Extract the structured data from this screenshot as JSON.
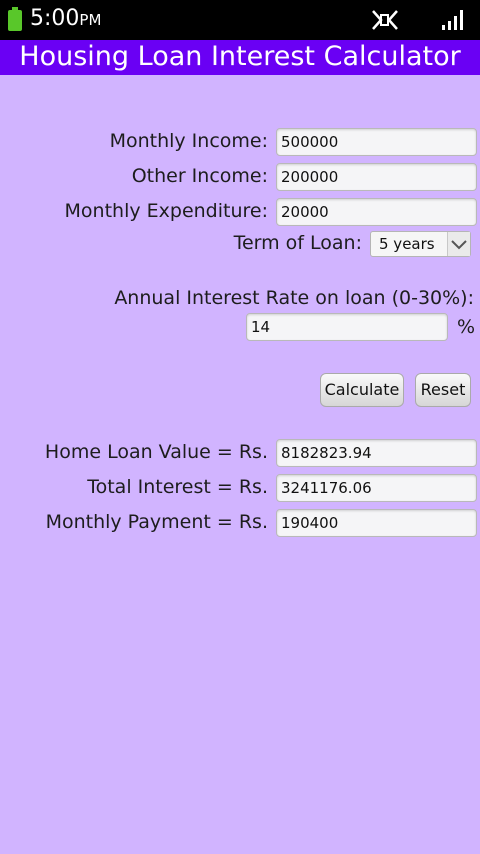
{
  "statusbar": {
    "time": "5:00",
    "ampm": "PM",
    "icons": [
      "battery-icon",
      "mute-icon",
      "signal-icon"
    ],
    "battery_color": "#59c72a"
  },
  "app": {
    "title": "Housing Loan Interest Calculator",
    "title_bar_color": "#6a00f4",
    "background_color": "#d1b4ff"
  },
  "form": {
    "monthly_income": {
      "label": "Monthly Income:",
      "value": "500000"
    },
    "other_income": {
      "label": "Other Income:",
      "value": "200000"
    },
    "monthly_expenditure": {
      "label": "Monthly Expenditure:",
      "value": "20000"
    },
    "term": {
      "label": "Term of Loan:",
      "value": "5 years"
    },
    "interest": {
      "label": "Annual Interest Rate on loan (0-30%):",
      "value": "14",
      "unit": "%"
    }
  },
  "buttons": {
    "calculate": "Calculate",
    "reset": "Reset"
  },
  "results": {
    "home_loan": {
      "label": "Home Loan Value = Rs.",
      "value": "8182823.94"
    },
    "total_interest": {
      "label": "Total Interest = Rs.",
      "value": "3241176.06"
    },
    "monthly_payment": {
      "label": "Monthly Payment = Rs.",
      "value": "190400"
    }
  }
}
